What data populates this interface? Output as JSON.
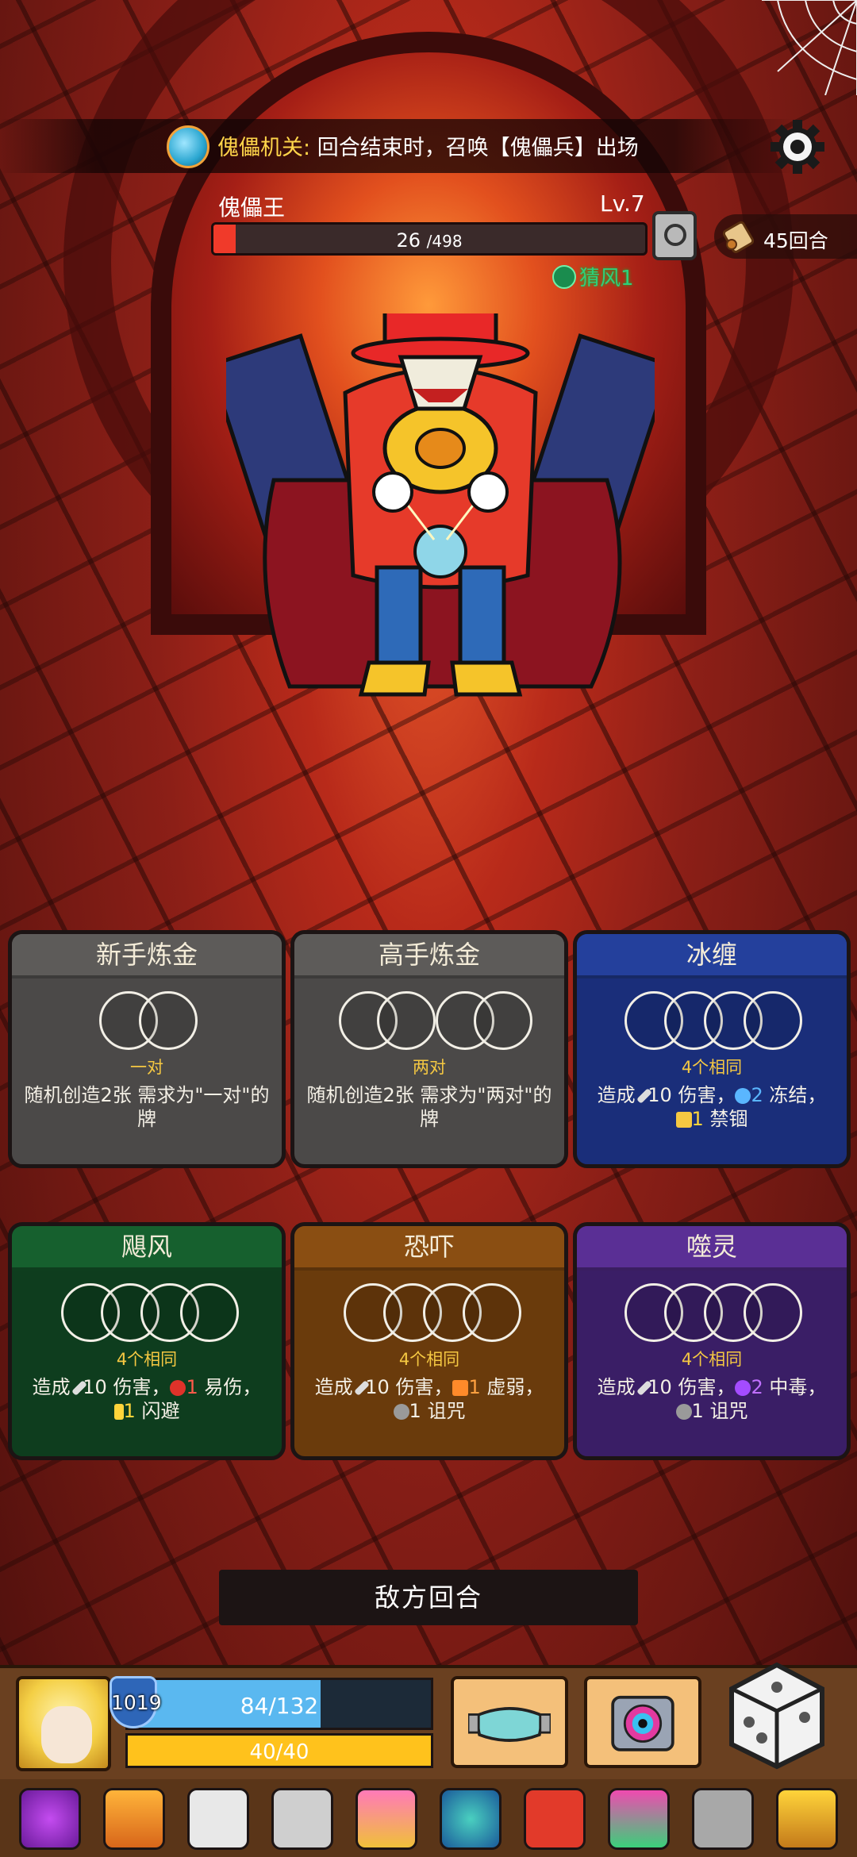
{
  "banner": {
    "mechanic_name": "傀儡机关",
    "colon": ":",
    "mechanic_text": " 回合结束时，召唤【傀儡兵】出场"
  },
  "boss": {
    "name": "傀儡王",
    "level": "Lv.7",
    "hp_current": "26",
    "hp_max": "/498",
    "hp_fraction": 0.052,
    "buff": "猜风1"
  },
  "round": {
    "label": "45回合"
  },
  "cards": [
    {
      "title": "新手炼金",
      "slots": 2,
      "requirement": "一对",
      "desc": "随机创造2张 需求为\"一对\"的牌"
    },
    {
      "title": "高手炼金",
      "slots": 4,
      "requirement": "两对",
      "desc": "随机创造2张 需求为\"两对\"的牌"
    },
    {
      "title": "冰缠",
      "slots": 4,
      "requirement": "4个相同",
      "desc_parts": {
        "a": "造成 ",
        "dmg": "10",
        "b": " 伤害，",
        "s1": "2",
        "s1_label": " 冻结，",
        "s2": "1",
        "s2_label": " 禁锢"
      }
    },
    {
      "title": "飓风",
      "slots": 4,
      "requirement": "4个相同",
      "desc_parts": {
        "a": "造成 ",
        "dmg": "10",
        "b": " 伤害，",
        "s1": "1",
        "s1_label": " 易伤，",
        "s2": "1",
        "s2_label": " 闪避"
      }
    },
    {
      "title": "恐吓",
      "slots": 4,
      "requirement": "4个相同",
      "desc_parts": {
        "a": "造成 ",
        "dmg": "10",
        "b": " 伤害，",
        "s1": "1",
        "s1_label": " 虚弱，",
        "s2": "1",
        "s2_label": " 诅咒"
      }
    },
    {
      "title": "噬灵",
      "slots": 4,
      "requirement": "4个相同",
      "desc_parts": {
        "a": "造成 ",
        "dmg": "10",
        "b": " 伤害，",
        "s1": "2",
        "s1_label": " 中毒，",
        "s2": "1",
        "s2_label": " 诅咒"
      }
    }
  ],
  "enemy_turn": "敌方回合",
  "player": {
    "armor": "1019",
    "hp": "84/132",
    "hp_fraction": 0.636,
    "energy": "40/40",
    "energy_fraction": 1.0
  },
  "icons": {
    "settings": "gear-icon",
    "inspect": "magnifier-icon",
    "round": "scroll-icon",
    "dice": "dice-icon"
  },
  "relics": [
    "potion-relic-icon",
    "cloak-relic-icon",
    "skull-relic-icon",
    "scroll-relic-icon",
    "heart-amulet-relic-icon",
    "demon-mask-relic-icon",
    "red-ring-relic-icon",
    "totem-relic-icon",
    "grey-crown-relic-icon",
    "gold-claw-relic-icon"
  ],
  "colors": {
    "hp_enemy": "#f03a2a",
    "hp_player": "#5ab8f0",
    "energy": "#ffc21c",
    "requirement_text": "#f5c842",
    "buff_text": "#2ed07a"
  }
}
